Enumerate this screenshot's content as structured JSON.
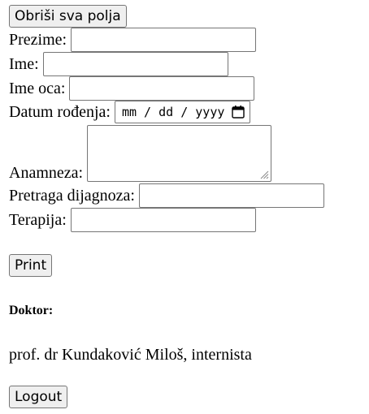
{
  "buttons": {
    "clear_all": "Obriši sva polja",
    "print": "Print",
    "logout": "Logout"
  },
  "form": {
    "prezime_label": "Prezime:",
    "ime_label": "Ime:",
    "ime_oca_label": "Ime oca:",
    "datum_label": "Datum rođenja:",
    "datum_placeholder": "mm / dd / yyyy",
    "anamneza_label": "Anamneza:",
    "pretraga_label": "Pretraga dijagnoza:",
    "terapija_label": "Terapija:"
  },
  "doctor": {
    "heading": "Doktor:",
    "name": "prof. dr Kundaković Miloš, internista"
  },
  "icons": {
    "date_picker": "calendar-icon",
    "resize": "resize-grip-icon"
  },
  "colors": {
    "button_bg": "#efefef",
    "border": "#767676"
  }
}
